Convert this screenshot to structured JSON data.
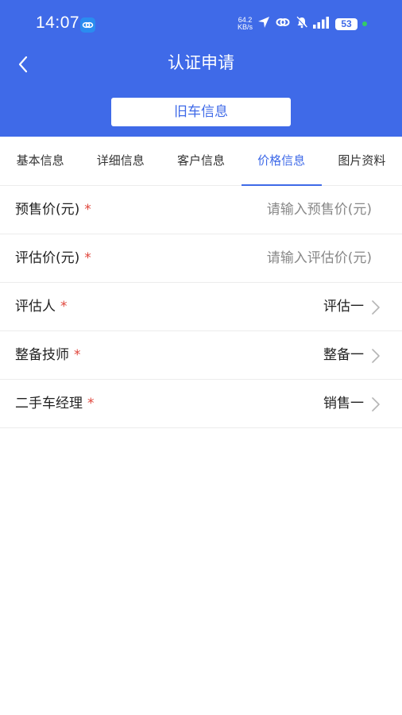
{
  "status_bar": {
    "time": "14:07",
    "net_speed_value": "64.2",
    "net_speed_unit": "KB/s",
    "battery": "53"
  },
  "header": {
    "title": "认证申请",
    "sub_button": "旧车信息"
  },
  "tabs": [
    {
      "label": "基本信息",
      "active": false
    },
    {
      "label": "详细信息",
      "active": false
    },
    {
      "label": "客户信息",
      "active": false
    },
    {
      "label": "价格信息",
      "active": true
    },
    {
      "label": "图片资料",
      "active": false
    }
  ],
  "form": {
    "presale_price": {
      "label": "预售价(元)",
      "required_mark": "*",
      "value": "",
      "placeholder": "请输入预售价(元)"
    },
    "assessed_price": {
      "label": "评估价(元)",
      "required_mark": "*",
      "value": "",
      "placeholder": "请输入评估价(元)"
    },
    "assessor": {
      "label": "评估人",
      "required_mark": "*",
      "value": "评估一"
    },
    "prep_technician": {
      "label": "整备技师",
      "required_mark": "*",
      "value": "整备一"
    },
    "used_car_manager": {
      "label": "二手车经理",
      "required_mark": "*",
      "value": "销售一"
    }
  },
  "colors": {
    "primary": "#3f6ae8",
    "required": "#e0453b",
    "divider": "#ececec"
  }
}
